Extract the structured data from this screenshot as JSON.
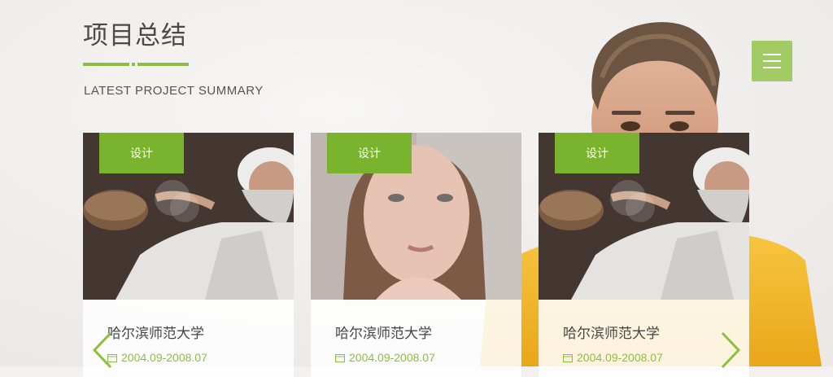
{
  "section": {
    "title": "项目总结",
    "subtitle": "LATEST PROJECT SUMMARY"
  },
  "menu": {
    "icon": "hamburger-menu-icon"
  },
  "colors": {
    "accent": "#8cbf3f",
    "tag_bg": "#7ab32e",
    "menu_bg": "#a3cb65",
    "arrow": "#8cbf3f",
    "sweater": "#f2b928"
  },
  "projects": [
    {
      "tag": "设计",
      "title": "哈尔滨师范大学",
      "date": "2004.09-2008.07",
      "image": "baker-photo"
    },
    {
      "tag": "设计",
      "title": "哈尔滨师范大学",
      "date": "2004.09-2008.07",
      "image": "woman-portrait-photo"
    },
    {
      "tag": "设计",
      "title": "哈尔滨师范大学",
      "date": "2004.09-2008.07",
      "image": "baker-photo"
    }
  ],
  "carousel": {
    "prev_icon": "chevron-left-icon",
    "next_icon": "chevron-right-icon"
  }
}
